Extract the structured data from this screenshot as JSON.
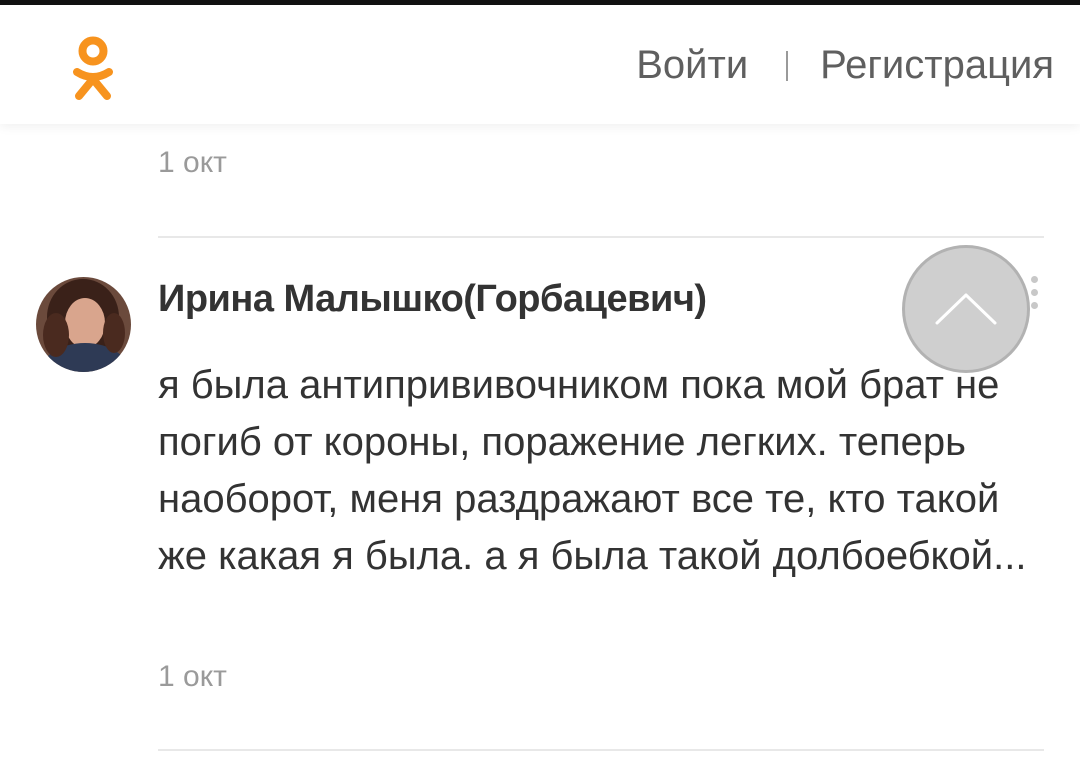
{
  "header": {
    "logo_icon": "odnoklassniki-logo-icon",
    "login_label": "Войти",
    "register_label": "Регистрация",
    "accent_color": "#f7931e"
  },
  "previous_comment": {
    "date": "1 окт"
  },
  "comment": {
    "author": "Ирина Малышко(Горбацевич)",
    "text": "я была антипрививочником пока мой брат не погиб от короны, поражение легких. теперь наоборот, меня раздражают все те, кто такой же какая я была. а я была такой долбоебкой...",
    "date": "1 окт"
  },
  "scroll_up_icon": "chevron-up-icon",
  "menu_icon": "more-vertical-icon"
}
